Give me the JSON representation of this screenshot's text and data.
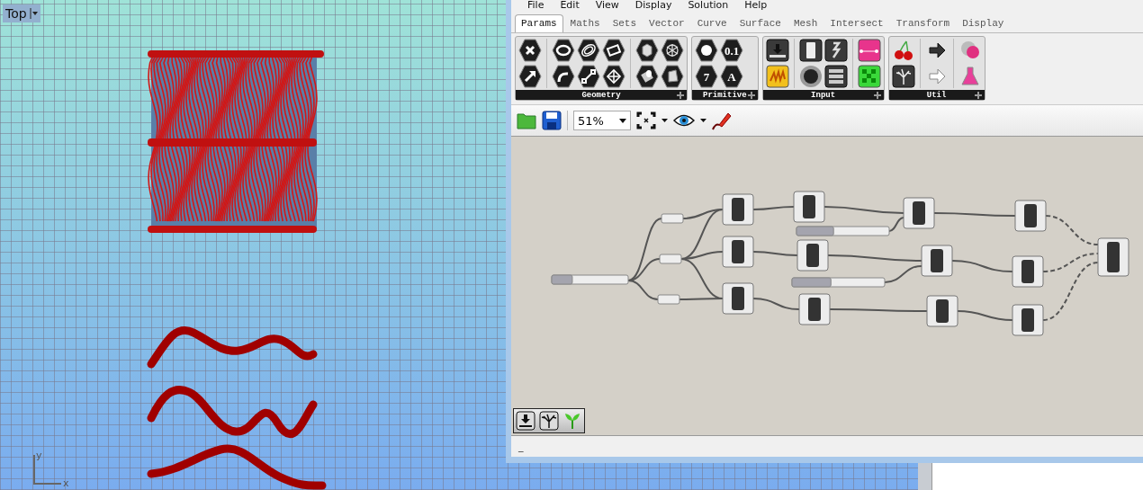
{
  "viewport": {
    "label": "Top",
    "axis_labels": [
      "y",
      "x"
    ]
  },
  "editor": {
    "menu": [
      "File",
      "Edit",
      "View",
      "Display",
      "Solution",
      "Help"
    ],
    "tabs": [
      {
        "label": "Params",
        "selected": true
      },
      {
        "label": "Maths",
        "selected": false
      },
      {
        "label": "Sets",
        "selected": false
      },
      {
        "label": "Vector",
        "selected": false
      },
      {
        "label": "Curve",
        "selected": false
      },
      {
        "label": "Surface",
        "selected": false
      },
      {
        "label": "Mesh",
        "selected": false
      },
      {
        "label": "Intersect",
        "selected": false
      },
      {
        "label": "Transform",
        "selected": false
      },
      {
        "label": "Display",
        "selected": false
      }
    ],
    "ribbon": [
      {
        "name": "Geometry"
      },
      {
        "name": "Primitive",
        "glyph_labels": [
          "0.1",
          "7",
          "A"
        ]
      },
      {
        "name": "Input"
      },
      {
        "name": "Util"
      }
    ],
    "zoom": "51%",
    "sliders": [
      {
        "level": 0.27
      },
      {
        "level": 0.4
      },
      {
        "level": 0.42
      }
    ],
    "status": "_"
  }
}
